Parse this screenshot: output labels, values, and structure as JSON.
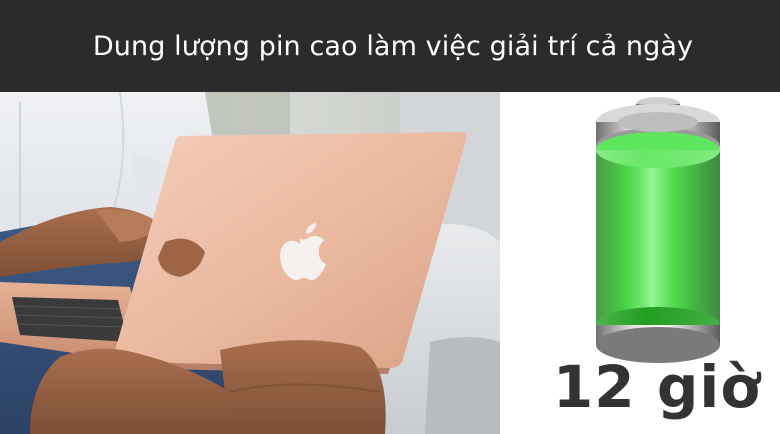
{
  "banner": {
    "title": "Dung lượng pin cao làm việc giải trí cả ngày"
  },
  "illustration": {
    "subject_icon": "laptop-on-lap-photo",
    "battery_icon": "battery-full-icon",
    "battery_level": 1.0,
    "battery_color": "#22cc22"
  },
  "battery_life": {
    "label": "12 giờ"
  },
  "colors": {
    "banner_background": "#2b2b2b",
    "banner_text": "#ffffff",
    "laptop_color": "#e8b39a",
    "label_text": "#333333"
  }
}
